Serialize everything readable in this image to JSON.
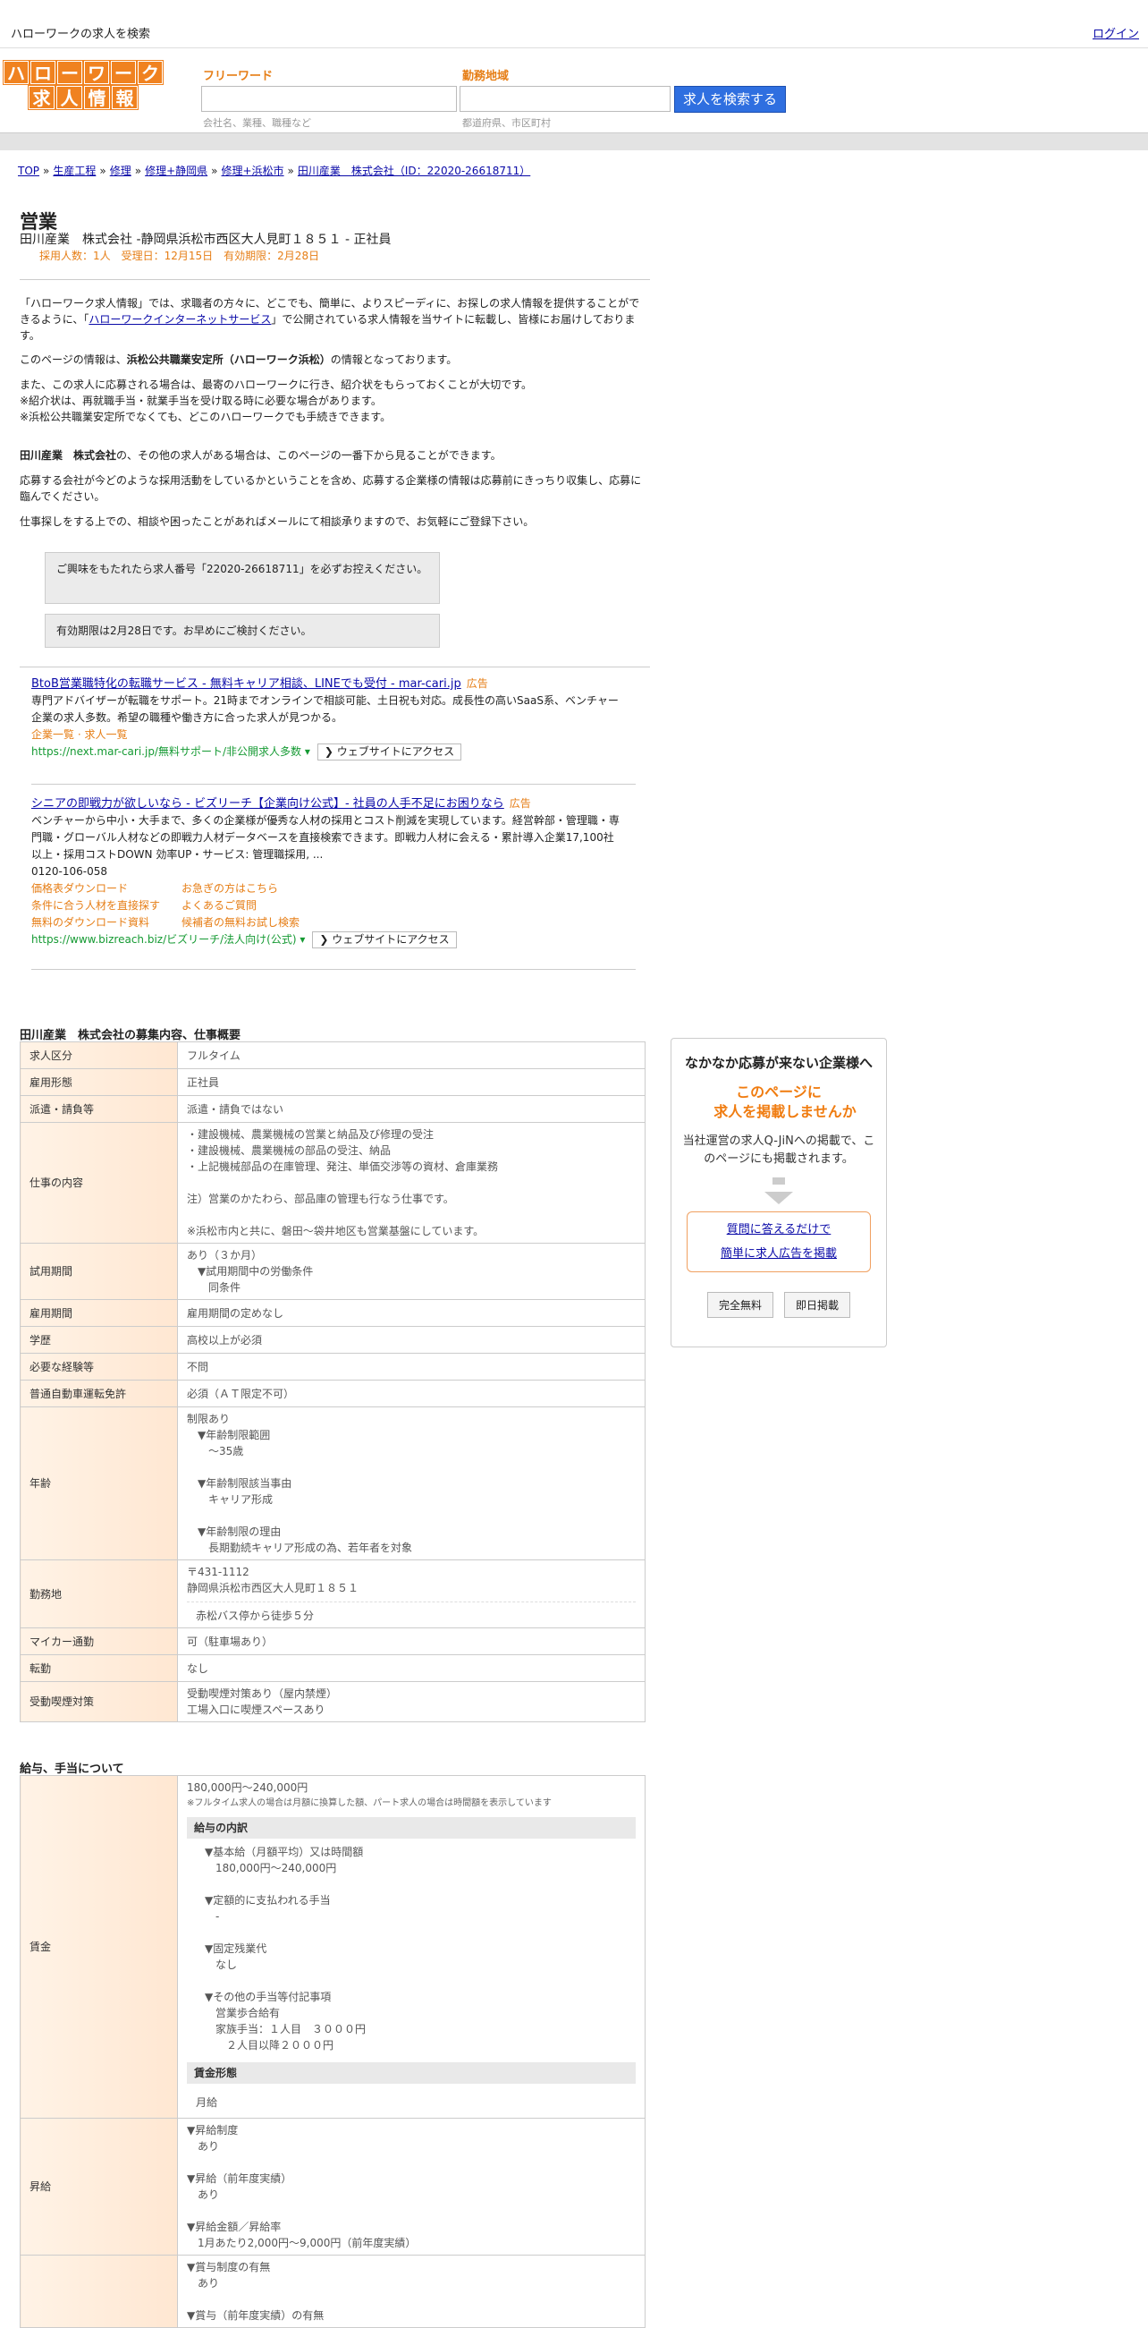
{
  "topbar": {
    "title": "ハローワークの求人を検索",
    "login": "ログイン"
  },
  "logo": {
    "row1": [
      "ハ",
      "ロ",
      "ー",
      "ワ",
      "ー",
      "ク"
    ],
    "row2": [
      "求",
      "人",
      "情",
      "報"
    ]
  },
  "search": {
    "keyword_label": "フリーワード",
    "keyword_placeholder": "会社名、業種、職種など",
    "area_label": "勤務地域",
    "area_placeholder": "都道府県、市区町村",
    "button": "求人を検索する"
  },
  "breadcrumb": [
    "TOP",
    "生産工程",
    "修理",
    "修理+静岡県",
    "修理+浜松市",
    "田川産業　株式会社（ID：22020-26618711）"
  ],
  "job": {
    "title": "営業",
    "subtitle": "田川産業　株式会社 -静岡県浜松市西区大人見町１８５１ - 正社員",
    "meta": "採用人数：1人　受理日：12月15日　有効期限：2月28日"
  },
  "intro": {
    "p1a": "「ハローワーク求人情報」では、求職者の方々に、どこでも、簡単に、よりスピーディに、お探しの求人情報を提供することができるように、「",
    "p1link": "ハローワークインターネットサービス",
    "p1b": "」で公開されている求人情報を当サイトに転載し、皆様にお届けしております。",
    "p2a": "このページの情報は、",
    "p2b": "浜松公共職業安定所（ハローワーク浜松）",
    "p2c": "の情報となっております。",
    "p3": "また、この求人に応募される場合は、最寄のハローワークに行き、紹介状をもらっておくことが大切です。\n※紹介状は、再就職手当・就業手当を受け取る時に必要な場合があります。\n※浜松公共職業安定所でなくても、どこのハローワークでも手続きできます。",
    "p4a": "田川産業　株式会社",
    "p4b": "の、その他の求人がある場合は、このページの一番下から見ることができます。",
    "p5": "応募する会社が今どのような採用活動をしているかということを含め、応募する企業様の情報は応募前にきっちり収集し、応募に臨んでください。",
    "p6": "仕事探しをする上での、相談や困ったことがあればメールにて相談承りますので、お気軽にご登録下さい。",
    "box1": "ご興味をもたれたら求人番号「22020-26618711」を必ずお控えください。",
    "box2": "有効期限は2月28日です。お早めにご検討ください。"
  },
  "ads": [
    {
      "title": "BtoB営業職特化の転職サービス - 無料キャリア相談、LINEでも受付 - mar-cari.jp",
      "tag": "広告",
      "desc": "専門アドバイザーが転職をサポート。21時までオンラインで相談可能、土日祝も対応。成長性の高いSaaS系、ベンチャー企業の求人多数。希望の職種や働き方に合った求人が見つかる。",
      "sitelink": "企業一覧 · 求人一覧",
      "url": "https://next.mar-cari.jp/無料サポート/非公開求人多数",
      "visit": "❯ ウェブサイトにアクセス"
    },
    {
      "title": "シニアの即戦力が欲しいなら - ビズリーチ【企業向け公式】- 社員の人手不足にお困りなら",
      "tag": "広告",
      "desc": "ベンチャーから中小・大手まで、多くの企業様が優秀な人材の採用とコスト削減を実現しています。経営幹部・管理職・専門職・グローバル人材などの即戦力人材データベースを直接検索できます。即戦力人材に会える・累計導入企業17,100社以上・採用コストDOWN 効率UP・サービス: 管理職採用, ...",
      "phone": "0120-106-058",
      "links": [
        "価格表ダウンロード",
        "お急ぎの方はこちら",
        "条件に合う人材を直接探す",
        "よくあるご質問",
        "無料のダウンロード資料",
        "候補者の無料お試し検索"
      ],
      "url": "https://www.bizreach.biz/ビズリーチ/法人向け(公式)",
      "visit": "❯ ウェブサイトにアクセス"
    }
  ],
  "section1": {
    "heading": "田川産業　株式会社の募集内容、仕事概要",
    "rows": [
      {
        "k": "求人区分",
        "v": "フルタイム"
      },
      {
        "k": "雇用形態",
        "v": "正社員"
      },
      {
        "k": "派遣・請負等",
        "v": "派遣・請負ではない"
      },
      {
        "k": "仕事の内容",
        "v": "・建設機械、農業機械の営業と納品及び修理の受注\n・建設機械、農業機械の部品の受注、納品\n・上記機械部品の在庫管理、発注、単価交渉等の資材、倉庫業務\n\n注）営業のかたわら、部品庫の管理も行なう仕事です。\n\n※浜松市内と共に、磐田～袋井地区も営業基盤にしています。"
      },
      {
        "k": "試用期間",
        "v": "あり（３か月）\n　▼試用期間中の労働条件\n　　同条件"
      },
      {
        "k": "雇用期間",
        "v": "雇用期間の定めなし"
      },
      {
        "k": "学歴",
        "v": "高校以上が必須"
      },
      {
        "k": "必要な経験等",
        "v": "不問"
      },
      {
        "k": "普通自動車運転免許",
        "v": "必須（ＡＴ限定不可）"
      },
      {
        "k": "年齢",
        "v": "制限あり\n　▼年齢制限範囲\n　　〜35歳\n\n　▼年齢制限該当事由\n　　キャリア形成\n\n　▼年齢制限の理由\n　　長期勤続キャリア形成の為、若年者を対象"
      },
      {
        "k": "勤務地",
        "v": "〒431-1112\n静岡県浜松市西区大人見町１８５１",
        "v2": "赤松バス停から徒歩５分"
      },
      {
        "k": "マイカー通勤",
        "v": "可（駐車場あり）"
      },
      {
        "k": "転勤",
        "v": "なし"
      },
      {
        "k": "受動喫煙対策",
        "v": "受動喫煙対策あり（屋内禁煙）\n工場入口に喫煙スペースあり"
      }
    ]
  },
  "section2": {
    "heading": "給与、手当について",
    "wage_label": "賃金",
    "wage_range": "180,000円〜240,000円",
    "wage_note": "※フルタイム求人の場合は月額に換算した額、パート求人の場合は時間額を表示しています",
    "breakdown_label": "給与の内訳",
    "breakdown": "▼基本給（月額平均）又は時間額\n　180,000円〜240,000円\n\n▼定額的に支払われる手当\n　-\n\n▼固定残業代\n　なし\n\n▼その他の手当等付記事項\n　営業歩合給有\n　家族手当：１人目　３０００円\n　　２人目以降２０００円",
    "form_label": "賃金形態",
    "form": "月給",
    "raise_label": "昇給",
    "raise": "▼昇給制度\n　あり\n\n▼昇給（前年度実績）\n　あり\n\n▼昇給金額／昇給率\n　1月あたり2,000円〜9,000円（前年度実績）",
    "bonus": "▼賞与制度の有無\n　あり\n\n▼賞与（前年度実績）の有無"
  },
  "sidebox": {
    "heading": "なかなか応募が来ない企業様へ",
    "offer1": "このページに",
    "offer2": "求人を掲載しませんか",
    "desc": "当社運営の求人Q-JiNへの掲載で、このページにも掲載されます。",
    "link1": "質問に答えるだけで",
    "link2": "簡単に求人広告を掲載",
    "btn1": "完全無料",
    "btn2": "即日掲載"
  }
}
